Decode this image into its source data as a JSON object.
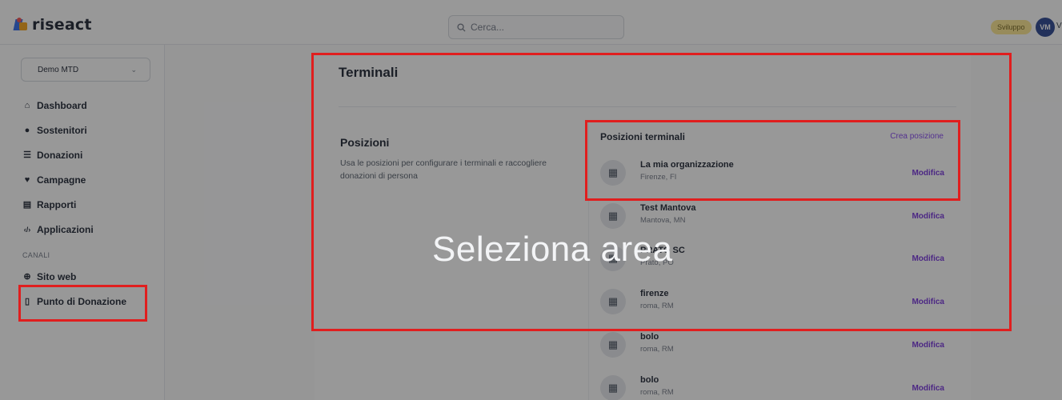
{
  "header": {
    "logo_text": "riseact",
    "search_placeholder": "Cerca...",
    "env_badge": "Sviluppo",
    "avatar_initials": "VM",
    "avatar_trailing": "V"
  },
  "sidebar": {
    "org_selector": "Demo MTD",
    "items": [
      {
        "label": "Dashboard",
        "icon": "home-icon",
        "glyph": "⌂"
      },
      {
        "label": "Sostenitori",
        "icon": "user-icon",
        "glyph": "●"
      },
      {
        "label": "Donazioni",
        "icon": "list-icon",
        "glyph": "☰"
      },
      {
        "label": "Campagne",
        "icon": "heart-icon",
        "glyph": "♥"
      },
      {
        "label": "Rapporti",
        "icon": "chart-icon",
        "glyph": "▤"
      },
      {
        "label": "Applicazioni",
        "icon": "code-icon",
        "glyph": "‹/›"
      }
    ],
    "channels_title": "CANALI",
    "channels": [
      {
        "label": "Sito web",
        "icon": "globe-icon",
        "glyph": "⊕"
      },
      {
        "label": "Punto di Donazione",
        "icon": "tablet-icon",
        "glyph": "▯"
      }
    ]
  },
  "main": {
    "title": "Terminali",
    "section_title": "Posizioni",
    "section_desc": "Usa le posizioni per configurare i terminali e raccogliere donazioni di persona",
    "list_title": "Posizioni terminali",
    "create_link": "Crea posizione",
    "rows": [
      {
        "name": "La mia organizzazione",
        "location": "Firenze, FI",
        "action": "Modifica"
      },
      {
        "name": "Test Mantova",
        "location": "Mantova, MN",
        "action": "Modifica"
      },
      {
        "name": "PRATO SC",
        "location": "Prato, PO",
        "action": "Modifica"
      },
      {
        "name": "firenze",
        "location": "roma, RM",
        "action": "Modifica"
      },
      {
        "name": "bolo",
        "location": "roma, RM",
        "action": "Modifica"
      },
      {
        "name": "bolo",
        "location": "roma, RM",
        "action": "Modifica"
      }
    ]
  },
  "overlay": {
    "label": "Seleziona area"
  },
  "colors": {
    "highlight": "#e01e1e",
    "accent": "#6d28d9",
    "badge": "#fde68a",
    "avatar": "#1e3a8a"
  }
}
